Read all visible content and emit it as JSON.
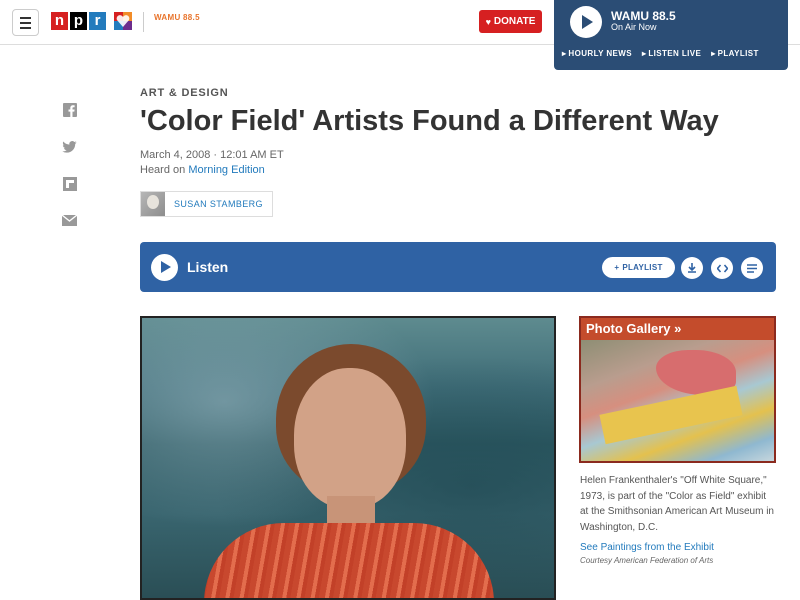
{
  "header": {
    "menu_label": "Menu",
    "npr_letters": [
      "n",
      "p",
      "r"
    ],
    "wamu_logo": "WAMU 88.5",
    "donate_label": "DONATE"
  },
  "player": {
    "station": "WAMU 88.5",
    "status": "On Air Now",
    "links": [
      "HOURLY NEWS",
      "LISTEN LIVE",
      "PLAYLIST"
    ]
  },
  "social": {
    "icons": [
      "facebook-icon",
      "twitter-icon",
      "flipboard-icon",
      "email-icon"
    ]
  },
  "article": {
    "slug": "ART & DESIGN",
    "title": "'Color Field' Artists Found a Different Way",
    "date": "March 4, 2008 · 12:01 AM ET",
    "heard_prefix": "Heard on ",
    "heard_show": "Morning Edition",
    "author": "SUSAN STAMBERG"
  },
  "listen_bar": {
    "label": "Listen",
    "playlist_label": "PLAYLIST",
    "icons": [
      "download-icon",
      "embed-icon",
      "transcript-icon"
    ]
  },
  "gallery": {
    "title": "Photo Gallery »",
    "caption": "Helen Frankenthaler's \"Off White Square,\" 1973, is part of the \"Color as Field\" exhibit at the Smithsonian American Art Museum in Washington, D.C.",
    "link": "See Paintings from the Exhibit",
    "credit": "Courtesy American Federation of Arts"
  },
  "colors": {
    "npr_red": "#d62021",
    "npr_blue": "#237bbd",
    "player_bg": "#2b4d75",
    "listen_bg": "#2f62a4"
  }
}
